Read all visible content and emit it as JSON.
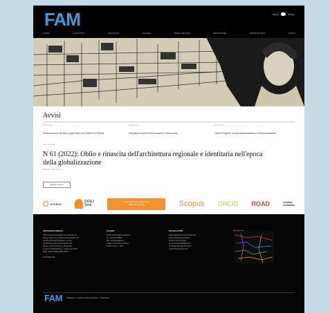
{
  "header": {
    "logo": "FAM",
    "lang_primary": "Italiano",
    "lang_secondary": "English"
  },
  "nav": {
    "items": [
      "HOME",
      "LA RIVISTA",
      "ARCHIVIO",
      "NUMERI",
      "PEER REVIEW",
      "REDAZIONE",
      "NEWSLETTER",
      "CERCA"
    ]
  },
  "avvisi": {
    "title": "Avvisi",
    "notices": [
      {
        "date": "2023-07-20",
        "text": "Presentazione del libro Luigi Franzi di FAMOSS di Roma"
      },
      {
        "date": "2023-03-15",
        "text": "Giornata di studi sul Monumento e Memoriale"
      },
      {
        "date": "2022-10-05",
        "text": "Call for Papers: eventi dell'architettura e Perfezionamento"
      }
    ]
  },
  "issue": {
    "meta": "Ultimo fascicolo",
    "title": "N 61 (2022): Oblio e rinascita dell'architettura regionale e identitaria nell'epoca della globalizzazione",
    "published": "Pubblicato: 2022-07-31",
    "button": "Vedi tutti i numeri"
  },
  "logos": {
    "open_access": "ACCESS",
    "doaj_line1": "DOAJ",
    "doaj_line2": "Seal",
    "esci_line1": "Emerging Sources Citation Index",
    "esci_line2": "WEB OF SCIENCE",
    "scopus": "Scopus",
    "orcid": "ORCID",
    "road": "ROAD",
    "cc_line1": "creative",
    "cc_line2": "commons"
  },
  "footer": {
    "col1_title": "Informazioni Editore",
    "col1_lines": [
      "FAM è una rivista scientifica internazionale ad",
      "accesso aperto che pubblica articoli originali e di",
      "ricerca dedicati all'architettura e la città.",
      "È indicizzata nelle principali banche dati",
      "(Scopus, ESCI, DOAJ) ed è classificata",
      "in Fascia A dall'ANVUR per i settori concorsuali",
      "08/C1, 08/D1, 08/E1, 08/E2, 08/F1."
    ],
    "col1_isbn": "ISSN 2039-0491",
    "col2_title": "Contatti",
    "col2_lines": [
      "Email: redazione@famagazine.it",
      "Tel. +39 051 6449961",
      "Sito: www.famagazine.it",
      "Indirizzo: Piazza Enea Natali 5",
      "40125 - Firenze - ITALY"
    ],
    "col3_title": "Gestione FAM",
    "col3_lines": [
      "FAM è pubblicata come periodico da",
      "Festival Architettura Edizioni",
      "Direttore: Enrico Prandi",
      "Codice Fiscale 92096110341",
      "Iscritta dal Tribunale di Parma",
      "",
      "Leggi l'informativa privacy"
    ],
    "col4_title": "Keywords",
    "copyright": "FAMagazine - Festival Architettura Edizioni · © 2013-2023"
  }
}
